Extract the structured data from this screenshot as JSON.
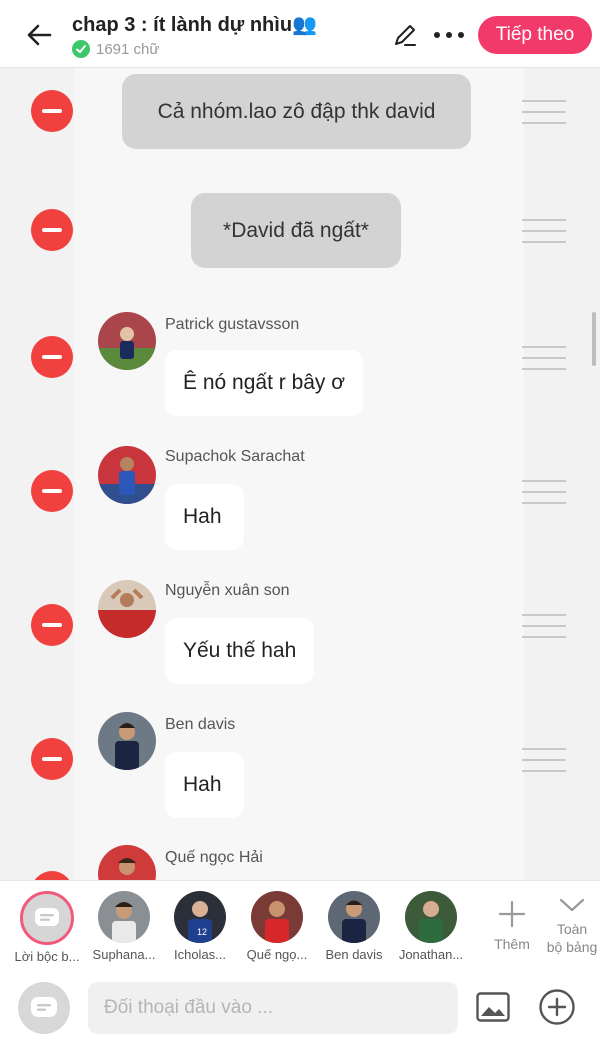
{
  "header": {
    "title": "chap 3 : ít lành dự nhìu",
    "title_emoji": "👥",
    "word_count": "1691 chữ",
    "next_label": "Tiếp theo",
    "accent": "#f23a6a"
  },
  "messages": [
    {
      "type": "narration",
      "text": "Cả nhóm.lao zô đập thk david"
    },
    {
      "type": "narration",
      "text": "*David đã ngất*"
    },
    {
      "type": "dialog",
      "name": "Patrick gustavsson",
      "text": "Ê nó ngất r bây ơ"
    },
    {
      "type": "dialog",
      "name": "Supachok Sarachat",
      "text": "Hah"
    },
    {
      "type": "dialog",
      "name": "Nguyễn xuân son",
      "text": "Yếu thế hah"
    },
    {
      "type": "dialog",
      "name": "Ben davis",
      "text": "Hah"
    },
    {
      "type": "dialog",
      "name": "Quế ngọc Hải",
      "text": ""
    }
  ],
  "characters": [
    {
      "label": "Lời bộc b..."
    },
    {
      "label": "Suphana..."
    },
    {
      "label": "Icholas..."
    },
    {
      "label": "Quế ngọ..."
    },
    {
      "label": "Ben davis"
    },
    {
      "label": "Jonathan..."
    }
  ],
  "toolbar": {
    "add_label": "Thêm",
    "all_board_label_1": "Toàn",
    "all_board_label_2": "bộ bảng"
  },
  "input": {
    "placeholder": "Đối thoại đầu vào ..."
  }
}
